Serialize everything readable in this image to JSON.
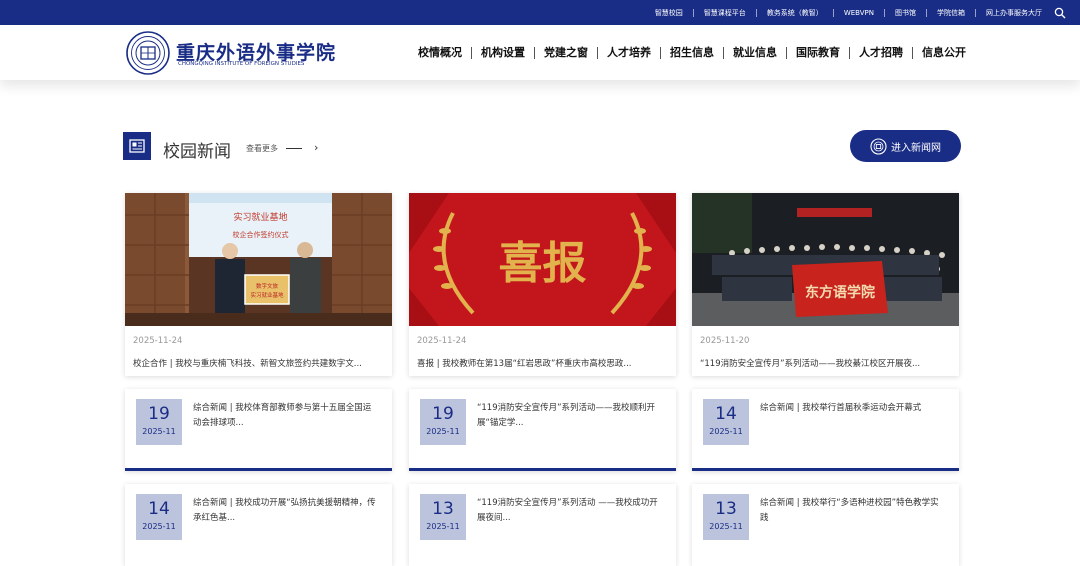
{
  "topbar": {
    "links": [
      "智慧校园",
      "智慧课程平台",
      "教务系统（教智）",
      "WEBVPN",
      "图书馆",
      "学院信箱",
      "网上办事服务大厅"
    ]
  },
  "header": {
    "logo_cn": "重庆外语外事学院",
    "logo_en": "CHONGQING INSTITUTE OF FOREIGN STUDIES",
    "nav": [
      "校情概况",
      "机构设置",
      "党建之窗",
      "人才培养",
      "招生信息",
      "就业信息",
      "国际教育",
      "人才招聘",
      "信息公开"
    ]
  },
  "section": {
    "title": "校园新闻",
    "more": "查看更多",
    "arrow": "›",
    "news_button": "进入新闻网"
  },
  "featured": [
    {
      "date": "2025-11-24",
      "title": "校企合作 | 我校与重庆楠飞科技、新智文旅签约共建数字文...",
      "image": {
        "banner_title": "实习就业基地",
        "banner_sub": "校企合作签约仪式",
        "plaque_line1": "数字文旅",
        "plaque_line2": "实习就业基地"
      }
    },
    {
      "date": "2025-11-24",
      "title": "喜报 | 我校教师在第13届“红岩思政”杯重庆市高校思政...",
      "image": {
        "headline": "喜报"
      }
    },
    {
      "date": "2025-11-20",
      "title": "“119消防安全宣传月”系列活动——我校綦江校区开展夜...",
      "image": {
        "flag_text": "东方语学院"
      }
    }
  ],
  "news_list": [
    {
      "day": "19",
      "ym": "2025-11",
      "title": "综合新闻 | 我校体育部教师参与第十五届全国运动会排球项..."
    },
    {
      "day": "19",
      "ym": "2025-11",
      "title": "“119消防安全宣传月”系列活动——我校顺利开展“锚定学..."
    },
    {
      "day": "14",
      "ym": "2025-11",
      "title": "综合新闻 | 我校举行首届秋季运动会开幕式"
    },
    {
      "day": "14",
      "ym": "2025-11",
      "title": "综合新闻 | 我校成功开展“弘扬抗美援朝精神，传承红色基..."
    },
    {
      "day": "13",
      "ym": "2025-11",
      "title": "“119消防安全宣传月”系列活动 ——我校成功开展夜间..."
    },
    {
      "day": "13",
      "ym": "2025-11",
      "title": "综合新闻 | 我校举行“多语种进校园”特色教学实践"
    }
  ],
  "icons": {
    "search": "search-icon",
    "section": "newspaper-icon",
    "emblem": "school-emblem-icon",
    "news_button": "globe-logo-icon"
  },
  "colors": {
    "brand_blue": "#1a2d86",
    "date_box": "#bcc3dc",
    "red_banner": "#c3161c",
    "gold": "#e2b24c"
  }
}
